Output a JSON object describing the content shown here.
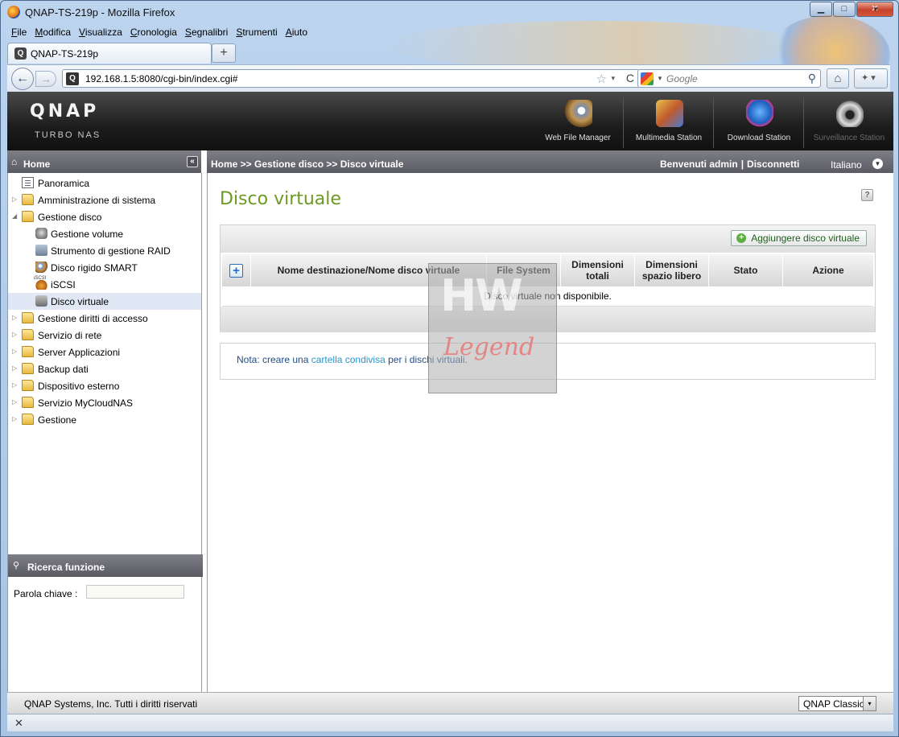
{
  "window": {
    "title": "QNAP-TS-219p - Mozilla Firefox",
    "minimize": "▁",
    "maximize": "□",
    "close": "✕"
  },
  "menu": [
    "File",
    "Modifica",
    "Visualizza",
    "Cronologia",
    "Segnalibri",
    "Strumenti",
    "Aiuto"
  ],
  "tabs": [
    {
      "label": "QNAP-TS-219p",
      "icon": "qnap-favicon"
    }
  ],
  "newtab_label": "+",
  "nav": {
    "back": "←",
    "forward": "→",
    "url": "192.168.1.5:8080/cgi-bin/index.cgi#",
    "star": "☆",
    "dropdown": "▾",
    "reload": "C",
    "search_placeholder": "Google",
    "search_glyph": "⚲",
    "home_glyph": "⌂",
    "ext_glyph": "✦ ▾"
  },
  "qnap": {
    "logo": "QNAP",
    "subtitle": "TURBO NAS",
    "apps": [
      {
        "label": "Web File Manager",
        "icon": "web-file-manager-icon",
        "enabled": true
      },
      {
        "label": "Multimedia Station",
        "icon": "multimedia-station-icon",
        "enabled": true
      },
      {
        "label": "Download Station",
        "icon": "download-station-icon",
        "enabled": true
      },
      {
        "label": "Surveillance Station",
        "icon": "surveillance-station-icon",
        "enabled": false
      }
    ]
  },
  "home_bar": {
    "label": "Home",
    "collapse": "«"
  },
  "breadcrumb": "Home >> Gestione disco >> Disco virtuale",
  "welcome": {
    "text": "Benvenuti admin",
    "separator": "|",
    "logout": "Disconnetti"
  },
  "language": "Italiano",
  "sidebar": {
    "items": [
      {
        "label": "Panoramica",
        "level": 0,
        "icon": "page",
        "arrow": ""
      },
      {
        "label": "Amministrazione di sistema",
        "level": 0,
        "icon": "folder",
        "arrow": "▷"
      },
      {
        "label": "Gestione disco",
        "level": 0,
        "icon": "folder",
        "arrow": "◢"
      },
      {
        "label": "Gestione volume",
        "level": 1,
        "icon": "disk"
      },
      {
        "label": "Strumento di gestione RAID",
        "level": 1,
        "icon": "raid"
      },
      {
        "label": "Disco rigido SMART",
        "level": 1,
        "icon": "smart"
      },
      {
        "label": "iSCSI",
        "level": 1,
        "icon": "iscsi"
      },
      {
        "label": "Disco virtuale",
        "level": 1,
        "icon": "vdisk",
        "selected": true
      },
      {
        "label": "Gestione diritti di accesso",
        "level": 0,
        "icon": "folder",
        "arrow": "▷"
      },
      {
        "label": "Servizio di rete",
        "level": 0,
        "icon": "folder",
        "arrow": "▷"
      },
      {
        "label": "Server Applicazioni",
        "level": 0,
        "icon": "folder",
        "arrow": "▷"
      },
      {
        "label": "Backup dati",
        "level": 0,
        "icon": "folder",
        "arrow": "▷"
      },
      {
        "label": "Dispositivo esterno",
        "level": 0,
        "icon": "folder",
        "arrow": "▷"
      },
      {
        "label": "Servizio MyCloudNAS",
        "level": 0,
        "icon": "folder",
        "arrow": "▷"
      },
      {
        "label": "Gestione",
        "level": 0,
        "icon": "folder",
        "arrow": "▷"
      }
    ]
  },
  "search_panel": {
    "title": "Ricerca funzione",
    "keyword_label": "Parola chiave :",
    "keyword_value": ""
  },
  "main": {
    "title": "Disco virtuale",
    "help": "?",
    "add_button": "Aggiungere disco virtuale",
    "add_glyph": "+",
    "table_plus": "+",
    "columns": [
      "Nome destinazione/Nome disco virtuale",
      "File System",
      "Dimensioni totali",
      "Dimensioni spazio libero",
      "Stato",
      "Azione"
    ],
    "empty_message": "Disco virtuale non disponibile.",
    "note_prefix": "Nota: creare una ",
    "note_link": "cartella condivisa",
    "note_suffix": " per i dischi virtuali."
  },
  "watermark": {
    "top": "HW",
    "bottom": "Legend"
  },
  "footer": {
    "copyright": "QNAP Systems, Inc. Tutti i diritti riservati",
    "theme": "QNAP Classic",
    "theme_arrow": "▾"
  },
  "statusbar": {
    "close": "✕"
  }
}
